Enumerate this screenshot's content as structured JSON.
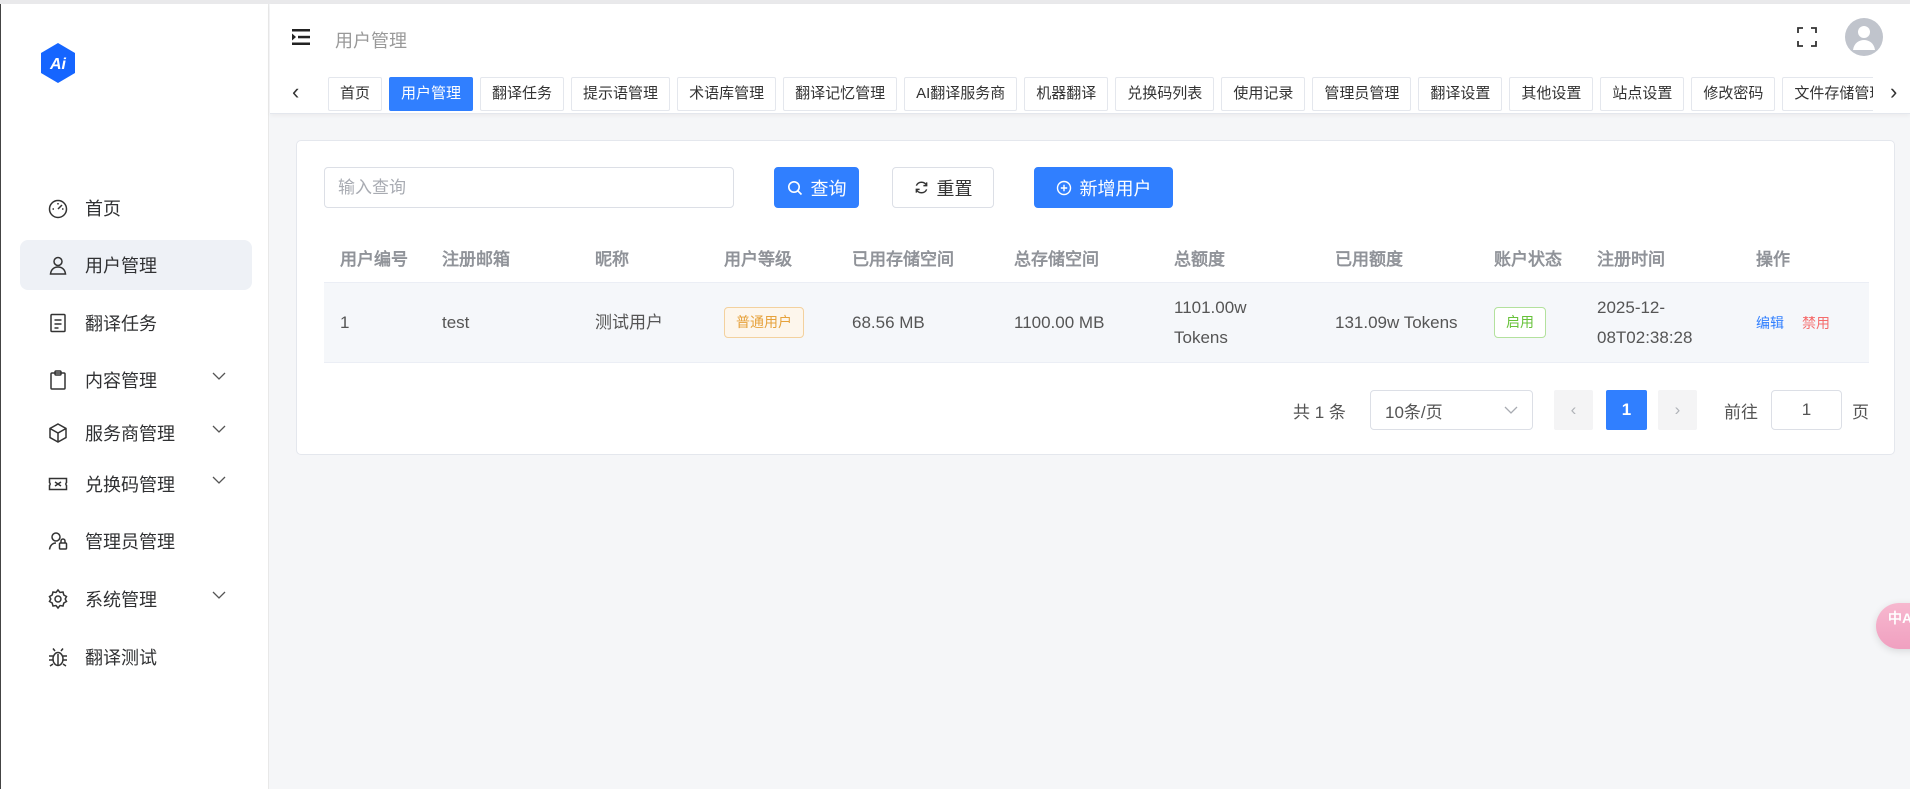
{
  "logo": {
    "text": "Ai",
    "color": "#1565ff"
  },
  "sidebar": {
    "items": [
      {
        "label": "首页",
        "icon": "dashboard-icon"
      },
      {
        "label": "用户管理",
        "icon": "user-icon",
        "active": true
      },
      {
        "label": "翻译任务",
        "icon": "document-icon"
      },
      {
        "label": "内容管理",
        "icon": "clipboard-icon",
        "expandable": true
      },
      {
        "label": "服务商管理",
        "icon": "box-icon",
        "expandable": true
      },
      {
        "label": "兑换码管理",
        "icon": "ticket-icon",
        "expandable": true
      },
      {
        "label": "管理员管理",
        "icon": "user-lock-icon"
      },
      {
        "label": "系统管理",
        "icon": "gear-icon",
        "expandable": true
      },
      {
        "label": "翻译测试",
        "icon": "bug-icon"
      }
    ]
  },
  "header": {
    "title": "用户管理"
  },
  "tags": [
    "首页",
    "用户管理",
    "翻译任务",
    "提示语管理",
    "术语库管理",
    "翻译记忆管理",
    "AI翻译服务商",
    "机器翻译",
    "兑换码列表",
    "使用记录",
    "管理员管理",
    "翻译设置",
    "其他设置",
    "站点设置",
    "修改密码",
    "文件存储管理"
  ],
  "active_tag": 1,
  "toolbar": {
    "search_placeholder": "输入查询",
    "search_value": "",
    "query": "查询",
    "reset": "重置",
    "add": "新增用户"
  },
  "table": {
    "columns": [
      "用户编号",
      "注册邮箱",
      "昵称",
      "用户等级",
      "已用存储空间",
      "总存储空间",
      "总额度",
      "已用额度",
      "账户状态",
      "注册时间",
      "操作"
    ],
    "rows": [
      {
        "id": "1",
        "email": "test",
        "nickname": "测试用户",
        "level": "普通用户",
        "used_storage": "68.56 MB",
        "total_storage": "1100.00 MB",
        "total_quota_1": "1101.00w",
        "total_quota_2": "Tokens",
        "used_quota": "131.09w Tokens",
        "status": "启用",
        "reg_time_1": "2025-12-",
        "reg_time_2": "08T02:38:28",
        "edit": "编辑",
        "disable": "禁用"
      }
    ]
  },
  "pagination": {
    "total": "共 1 条",
    "page_size": "10条/页",
    "current": "1",
    "goto_label": "前往",
    "goto_value": "1",
    "page_unit": "页"
  },
  "float_button": {
    "text": "中A"
  },
  "colors": {
    "primary": "#307fff",
    "warning": "#e6a23c",
    "success": "#67c23a",
    "danger": "#f56c6c"
  }
}
